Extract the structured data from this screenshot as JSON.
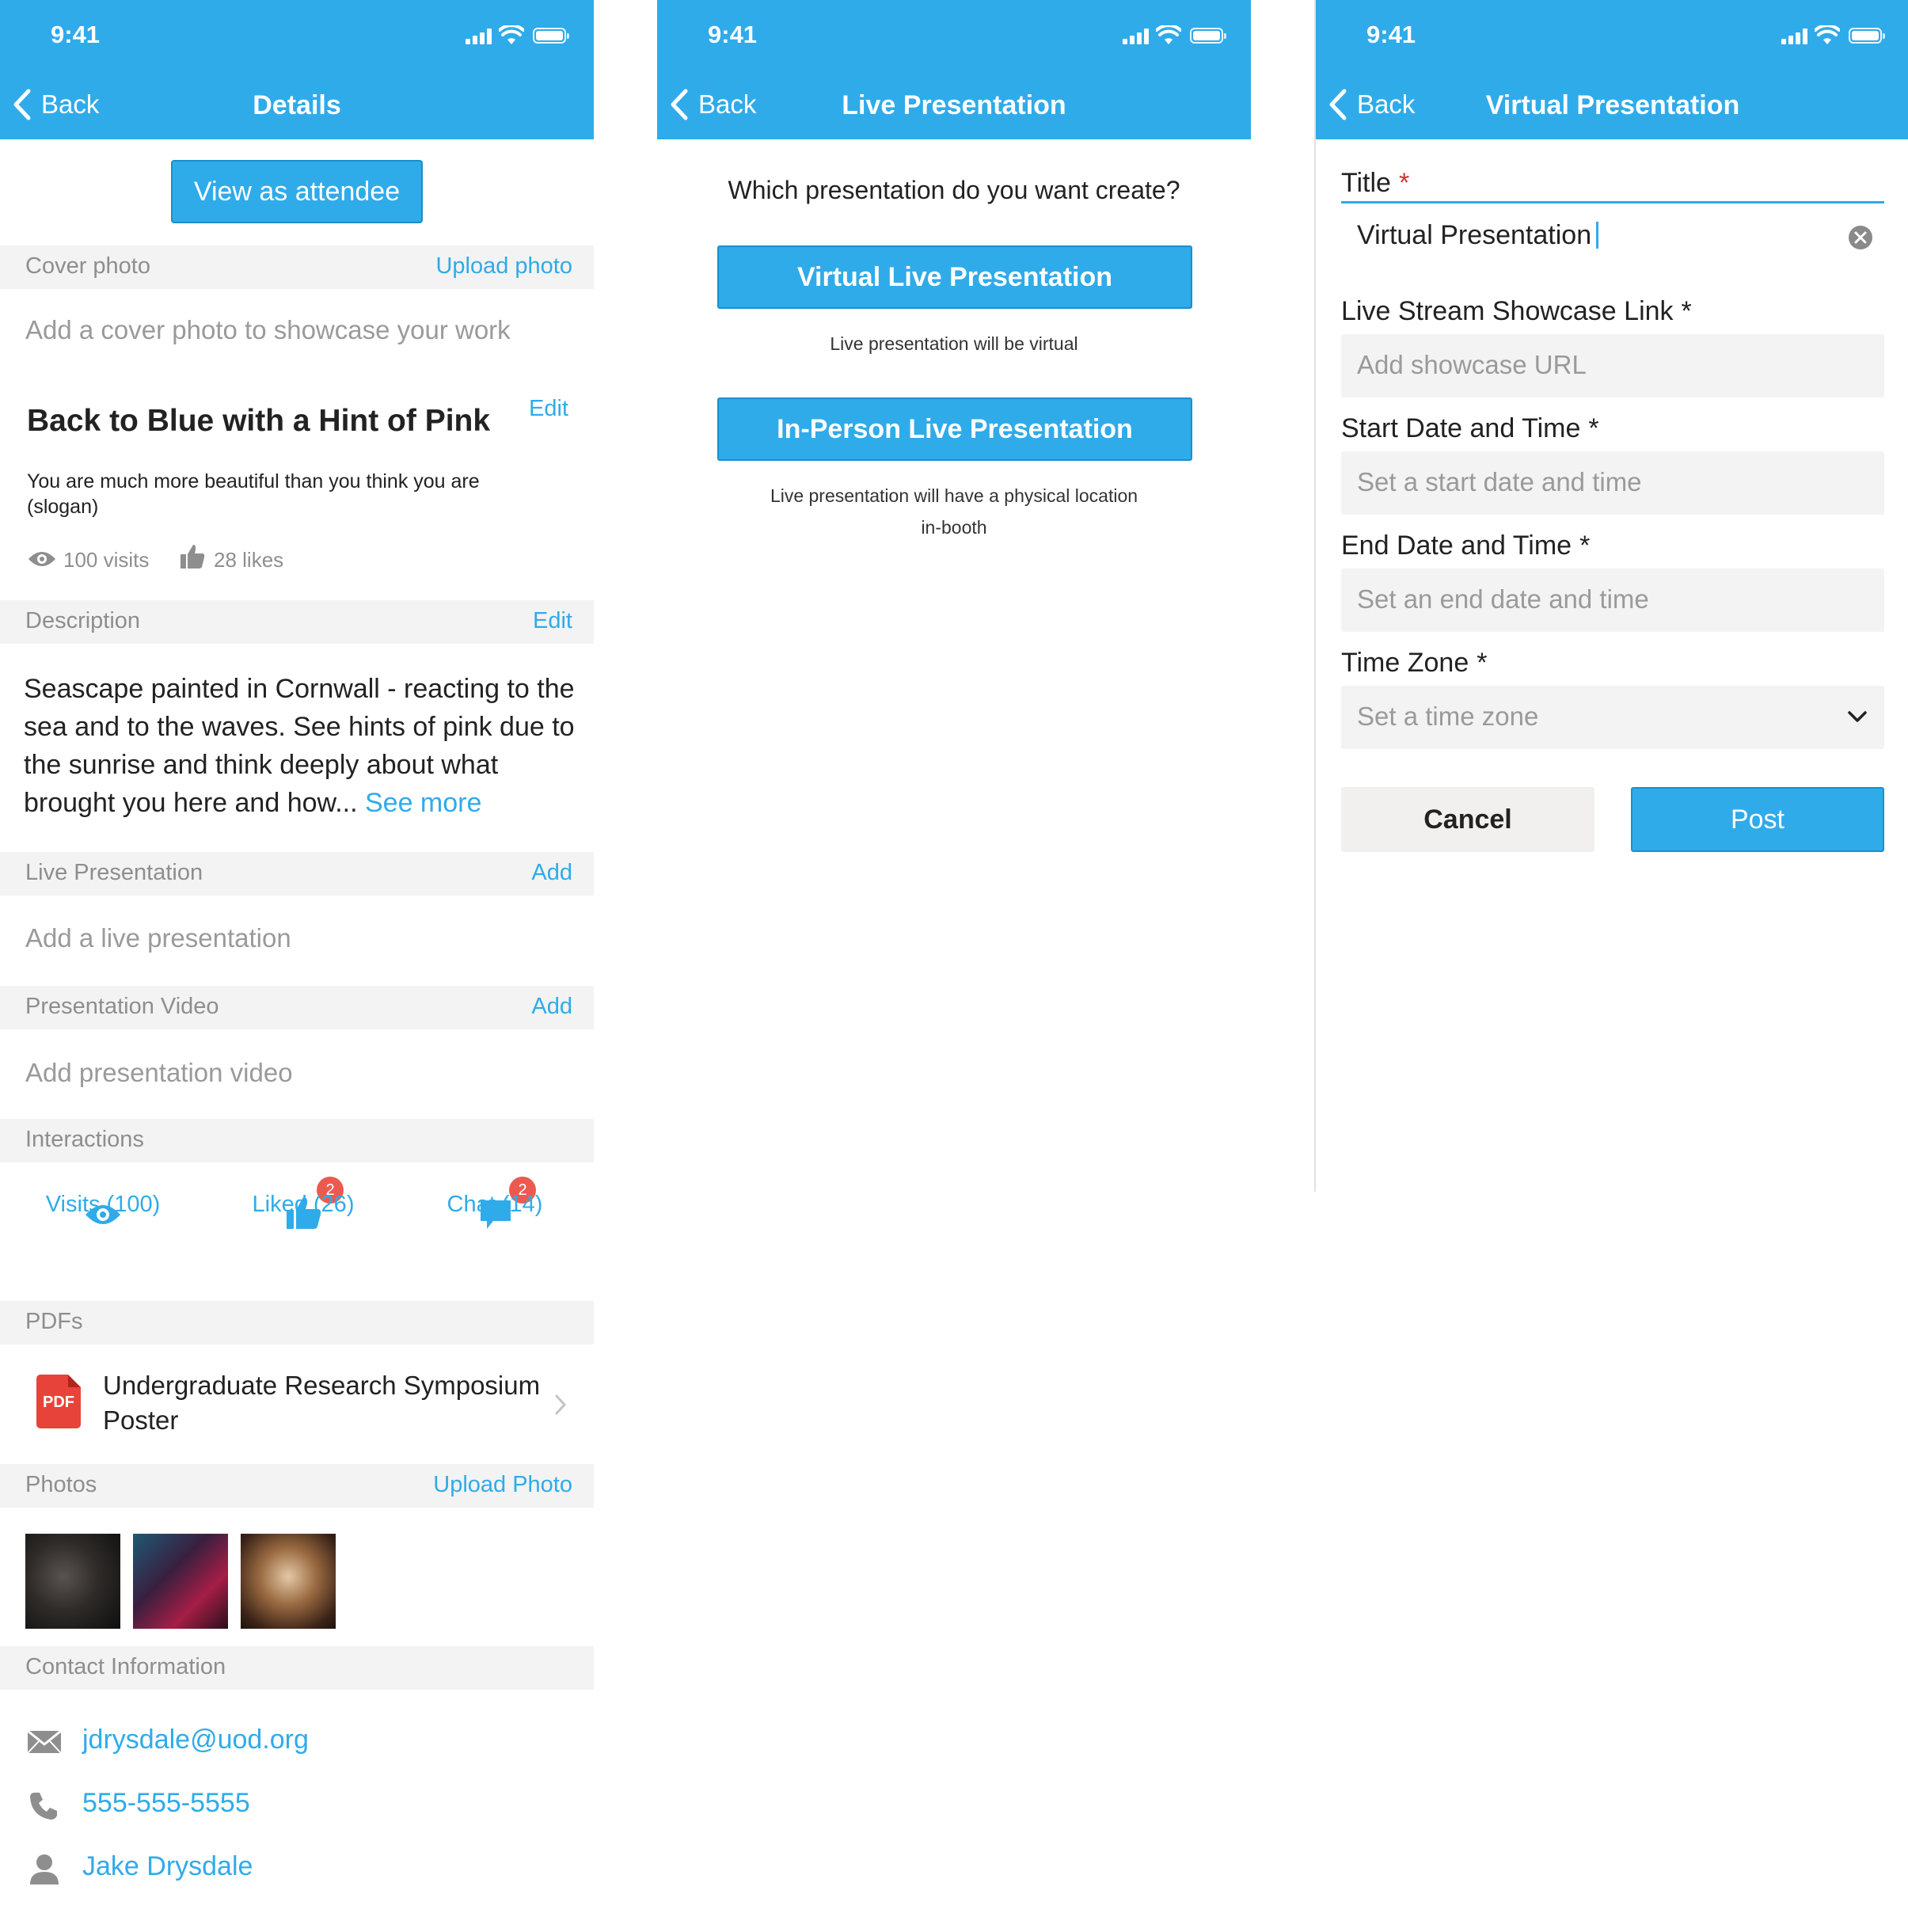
{
  "status": {
    "time": "9:41"
  },
  "details": {
    "header": {
      "back": "Back",
      "title": "Details"
    },
    "view_attendee": "View as attendee",
    "cover": {
      "label": "Cover photo",
      "action": "Upload photo",
      "placeholder": "Add a cover photo to showcase your work"
    },
    "project": {
      "title": "Back to Blue with a Hint of Pink",
      "edit": "Edit",
      "slogan": "You are much more beautiful than you think you are (slogan)",
      "visits": "100 visits",
      "likes": "28 likes"
    },
    "description": {
      "label": "Description",
      "action": "Edit",
      "text": "Seascape painted in Cornwall - reacting to the sea and to the waves. See hints of pink due to the sunrise and think deeply about what brought you here and how...",
      "more": "See more"
    },
    "live": {
      "label": "Live Presentation",
      "action": "Add",
      "placeholder": "Add a live presentation"
    },
    "video": {
      "label": "Presentation Video",
      "action": "Add",
      "placeholder": "Add presentation video"
    },
    "interactions": {
      "label": "Interactions",
      "visits": "Visits (100)",
      "liked": "Liked (26)",
      "liked_badge": "2",
      "chat": "Chat (14)",
      "chat_badge": "2"
    },
    "pdfs": {
      "label": "PDFs",
      "icon_text": "PDF",
      "item": "Undergraduate Research Symposium Poster"
    },
    "photos": {
      "label": "Photos",
      "action": "Upload Photo"
    },
    "contact": {
      "label": "Contact Information",
      "email": "jdrysdale@uod.org",
      "phone": "555-555-5555",
      "name": "Jake Drysdale"
    }
  },
  "live_presentation": {
    "header": {
      "back": "Back",
      "title": "Live Presentation"
    },
    "question": "Which presentation do you want create?",
    "virtual": {
      "label": "Virtual Live Presentation",
      "caption": "Live presentation will be virtual"
    },
    "in_person": {
      "label": "In-Person Live Presentation",
      "caption1": "Live presentation will have a physical location",
      "caption2": "in-booth"
    }
  },
  "virtual_presentation": {
    "header": {
      "back": "Back",
      "title": "Virtual Presentation"
    },
    "title_label": "Title",
    "title_value": "Virtual Presentation",
    "link_label": "Live Stream Showcase Link",
    "link_placeholder": "Add showcase URL",
    "start_label": "Start Date and Time",
    "start_placeholder": "Set a start date and time",
    "end_label": "End Date and Time",
    "end_placeholder": "Set an end date and time",
    "tz_label": "Time Zone",
    "tz_placeholder": "Set a time zone",
    "required_mark": "*",
    "cancel": "Cancel",
    "post": "Post"
  },
  "colors": {
    "accent": "#2fabea",
    "badge": "#ec5a4f",
    "pdf": "#e8433a"
  }
}
